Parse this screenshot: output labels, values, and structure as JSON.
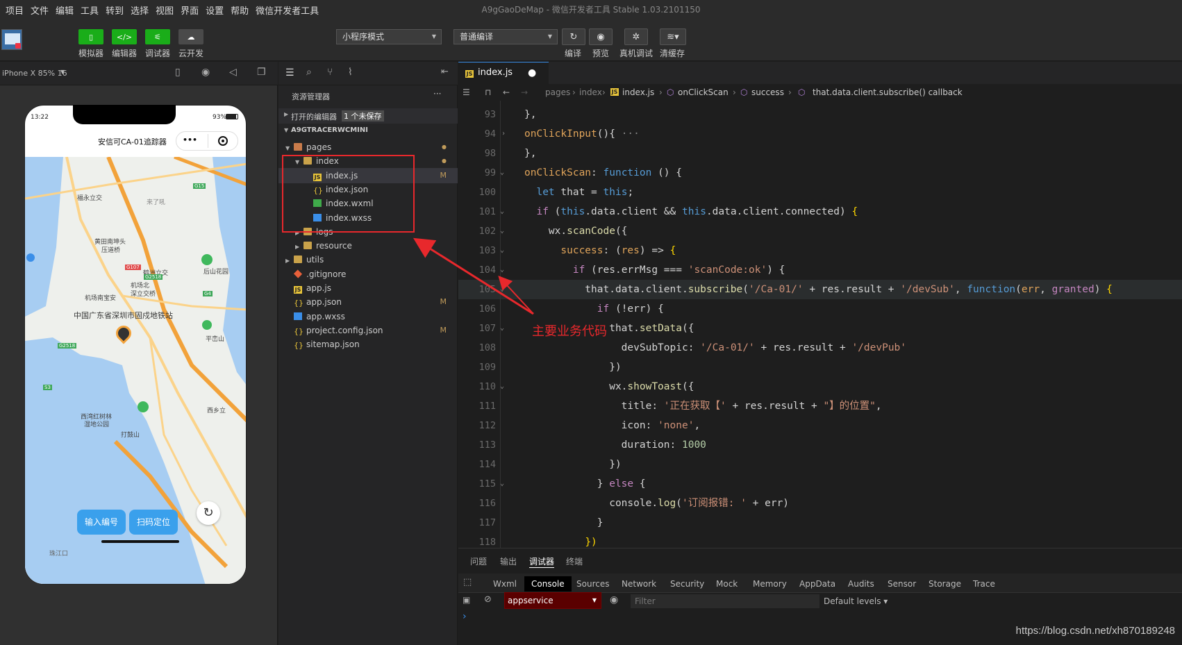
{
  "menu": [
    "项目",
    "文件",
    "编辑",
    "工具",
    "转到",
    "选择",
    "视图",
    "界面",
    "设置",
    "帮助",
    "微信开发者工具"
  ],
  "window_title": "A9gGaoDeMap - 微信开发者工具 Stable 1.03.2101150",
  "toolbar": {
    "simulator": "模拟器",
    "editor": "编辑器",
    "debugger": "调试器",
    "cloud": "云开发",
    "mode_select": "小程序模式",
    "compile_select": "普通编译",
    "compile": "编译",
    "preview": "预览",
    "remote_debug": "真机调试",
    "clear_cache": "清缓存"
  },
  "simulator": {
    "device": "iPhone X 85% 16",
    "status_time": "13:22",
    "status_battery": "93%",
    "nav_title": "安信可CA-01追踪器",
    "nav_more": "•••",
    "btn_input": "输入编号",
    "btn_scan": "扫码定位",
    "map_labels": [
      "福永立交",
      "黄田南坤头",
      "压道桥",
      "机场南宝安",
      "机场北",
      "深立交桥",
      "中国广东省深圳市固戍地铁站",
      "西湾红树林",
      "湿地公园",
      "打鼓山",
      "后山花园",
      "平峦山",
      "西乡立",
      "珠江口",
      "来了吼",
      "鹤洲立交",
      "G15",
      "G107",
      "G2518",
      "G4",
      "S3",
      "G2518"
    ]
  },
  "explorer": {
    "title": "资源管理器",
    "more": "···",
    "open_editors": "打开的编辑器",
    "unsaved_badge": "1 个未保存",
    "project": "A9GTRACERWCMINI",
    "tree": [
      {
        "name": "pages",
        "type": "folder-pages",
        "indent": 1,
        "mark": "●"
      },
      {
        "name": "index",
        "type": "folder-open",
        "indent": 2,
        "mark": "●"
      },
      {
        "name": "index.js",
        "type": "js",
        "indent": 3,
        "mark": "M",
        "selected": true
      },
      {
        "name": "index.json",
        "type": "json",
        "indent": 3,
        "mark": ""
      },
      {
        "name": "index.wxml",
        "type": "wxml",
        "indent": 3,
        "mark": ""
      },
      {
        "name": "index.wxss",
        "type": "wxss",
        "indent": 3,
        "mark": ""
      },
      {
        "name": "logs",
        "type": "folder",
        "indent": 2,
        "mark": ""
      },
      {
        "name": "resource",
        "type": "folder",
        "indent": 2,
        "mark": ""
      },
      {
        "name": "utils",
        "type": "folder",
        "indent": 1,
        "mark": ""
      },
      {
        "name": ".gitignore",
        "type": "git",
        "indent": 1,
        "mark": ""
      },
      {
        "name": "app.js",
        "type": "js",
        "indent": 1,
        "mark": ""
      },
      {
        "name": "app.json",
        "type": "json",
        "indent": 1,
        "mark": "M"
      },
      {
        "name": "app.wxss",
        "type": "wxss",
        "indent": 1,
        "mark": ""
      },
      {
        "name": "project.config.json",
        "type": "json",
        "indent": 1,
        "mark": "M"
      },
      {
        "name": "sitemap.json",
        "type": "json",
        "indent": 1,
        "mark": ""
      }
    ]
  },
  "editor": {
    "tab": "index.js",
    "breadcrumb": [
      "pages",
      "index",
      "index.js",
      "onClickScan",
      "success",
      "that.data.client.subscribe() callback"
    ],
    "line_numbers": [
      "93",
      "94",
      "98",
      "99",
      "100",
      "101",
      "102",
      "103",
      "104",
      "105",
      "106",
      "107",
      "108",
      "109",
      "110",
      "111",
      "112",
      "113",
      "114",
      "115",
      "116",
      "117",
      "118"
    ]
  },
  "panel": {
    "tabs": [
      "问题",
      "输出",
      "调试器",
      "终端"
    ],
    "devtabs": [
      "Wxml",
      "Console",
      "Sources",
      "Network",
      "Security",
      "Mock",
      "Memory",
      "AppData",
      "Audits",
      "Sensor",
      "Storage",
      "Trace"
    ],
    "context": "appservice",
    "filter_placeholder": "Filter",
    "levels": "Default levels ▾",
    "prompt": "›"
  },
  "annotation": "主要业务代码",
  "watermark": "https://blog.csdn.net/xh870189248",
  "colors": {
    "accent_green": "#1aad19",
    "annotation_red": "#e8282c",
    "console_context_bg": "#5a0000"
  }
}
